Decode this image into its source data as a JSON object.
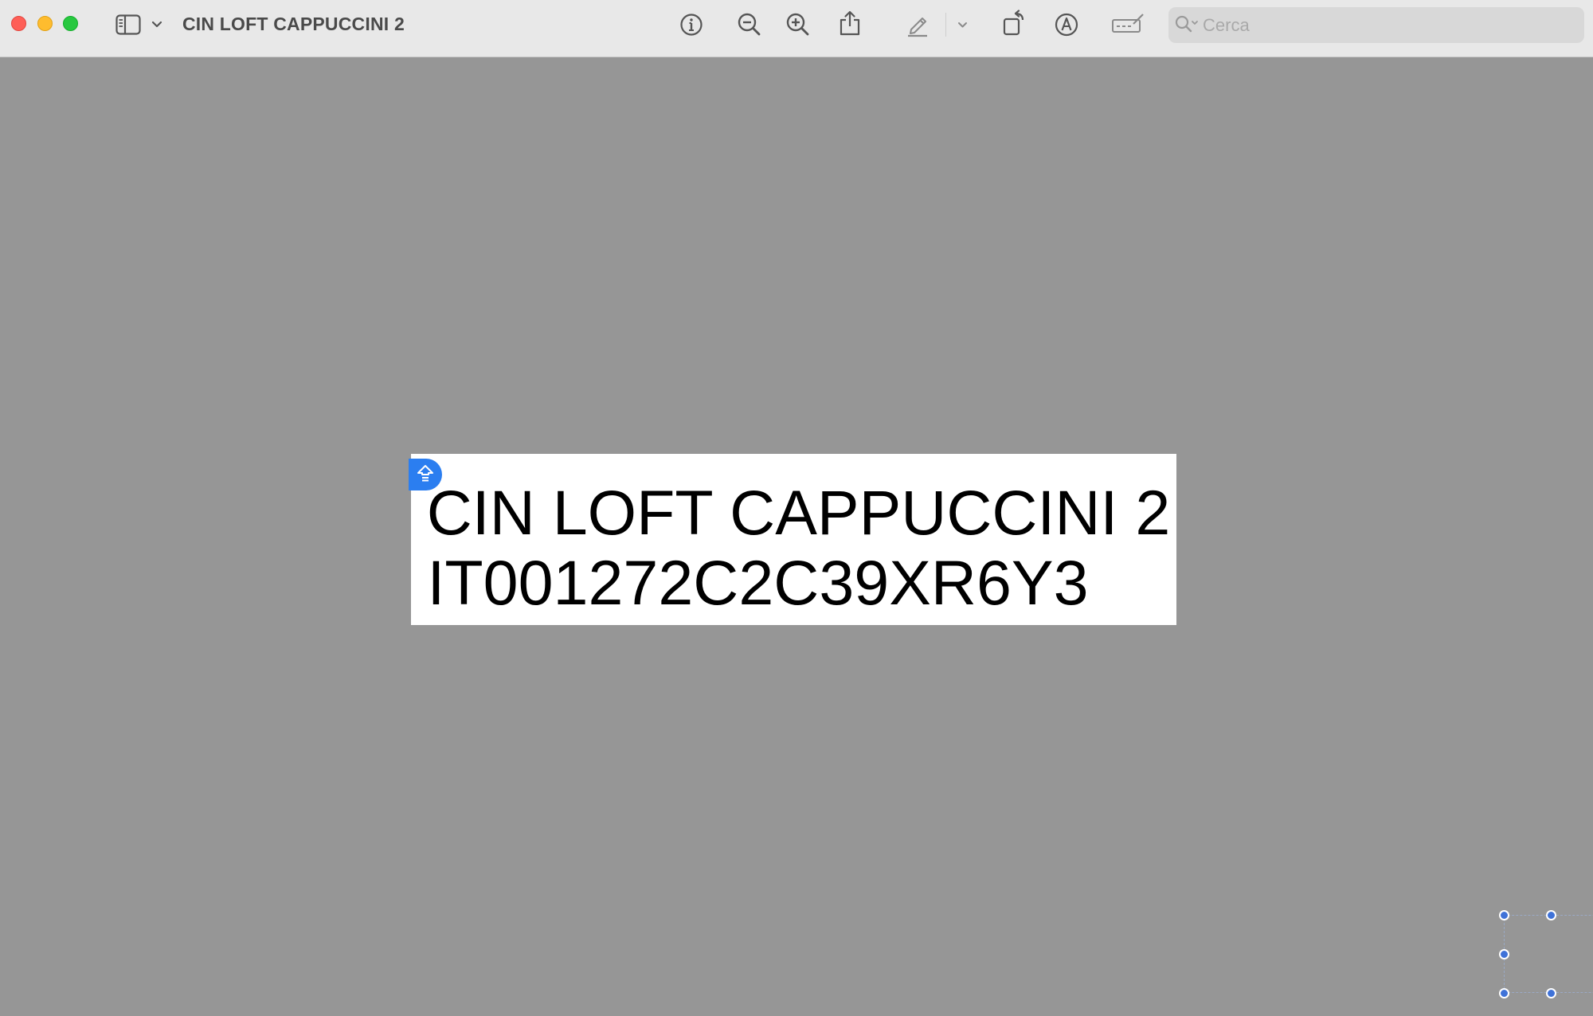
{
  "window": {
    "title": "CIN LOFT CAPPUCCINI 2",
    "traffic_lights": [
      "close",
      "minimize",
      "zoom"
    ]
  },
  "toolbar": {
    "sidebar_button_icon": "sidebar-icon",
    "sidebar_menu_icon": "chevron-down-icon",
    "buttons": [
      {
        "name": "info",
        "icon": "info-circle-icon"
      },
      {
        "name": "zoom-out",
        "icon": "zoom-out-icon"
      },
      {
        "name": "zoom-in",
        "icon": "zoom-in-icon"
      },
      {
        "name": "share",
        "icon": "share-icon"
      },
      {
        "name": "highlight",
        "icon": "pencil-icon"
      },
      {
        "name": "highlight-menu",
        "icon": "chevron-down-icon"
      },
      {
        "name": "rotate",
        "icon": "rotate-icon"
      },
      {
        "name": "markup",
        "icon": "markup-icon"
      },
      {
        "name": "form-fill",
        "icon": "form-icon"
      }
    ],
    "search": {
      "placeholder": "Cerca",
      "value": "",
      "icon": "search-icon"
    }
  },
  "document": {
    "lines": [
      "CIN LOFT CAPPUCCINI 2",
      "IT001272C2C39XR6Y3"
    ],
    "badge_icon": "home-up-icon",
    "badge_color": "#2b7ef0"
  },
  "colors": {
    "canvas_background": "#969696",
    "toolbar_background": "#e8e8e8",
    "accent": "#3f72d8"
  }
}
